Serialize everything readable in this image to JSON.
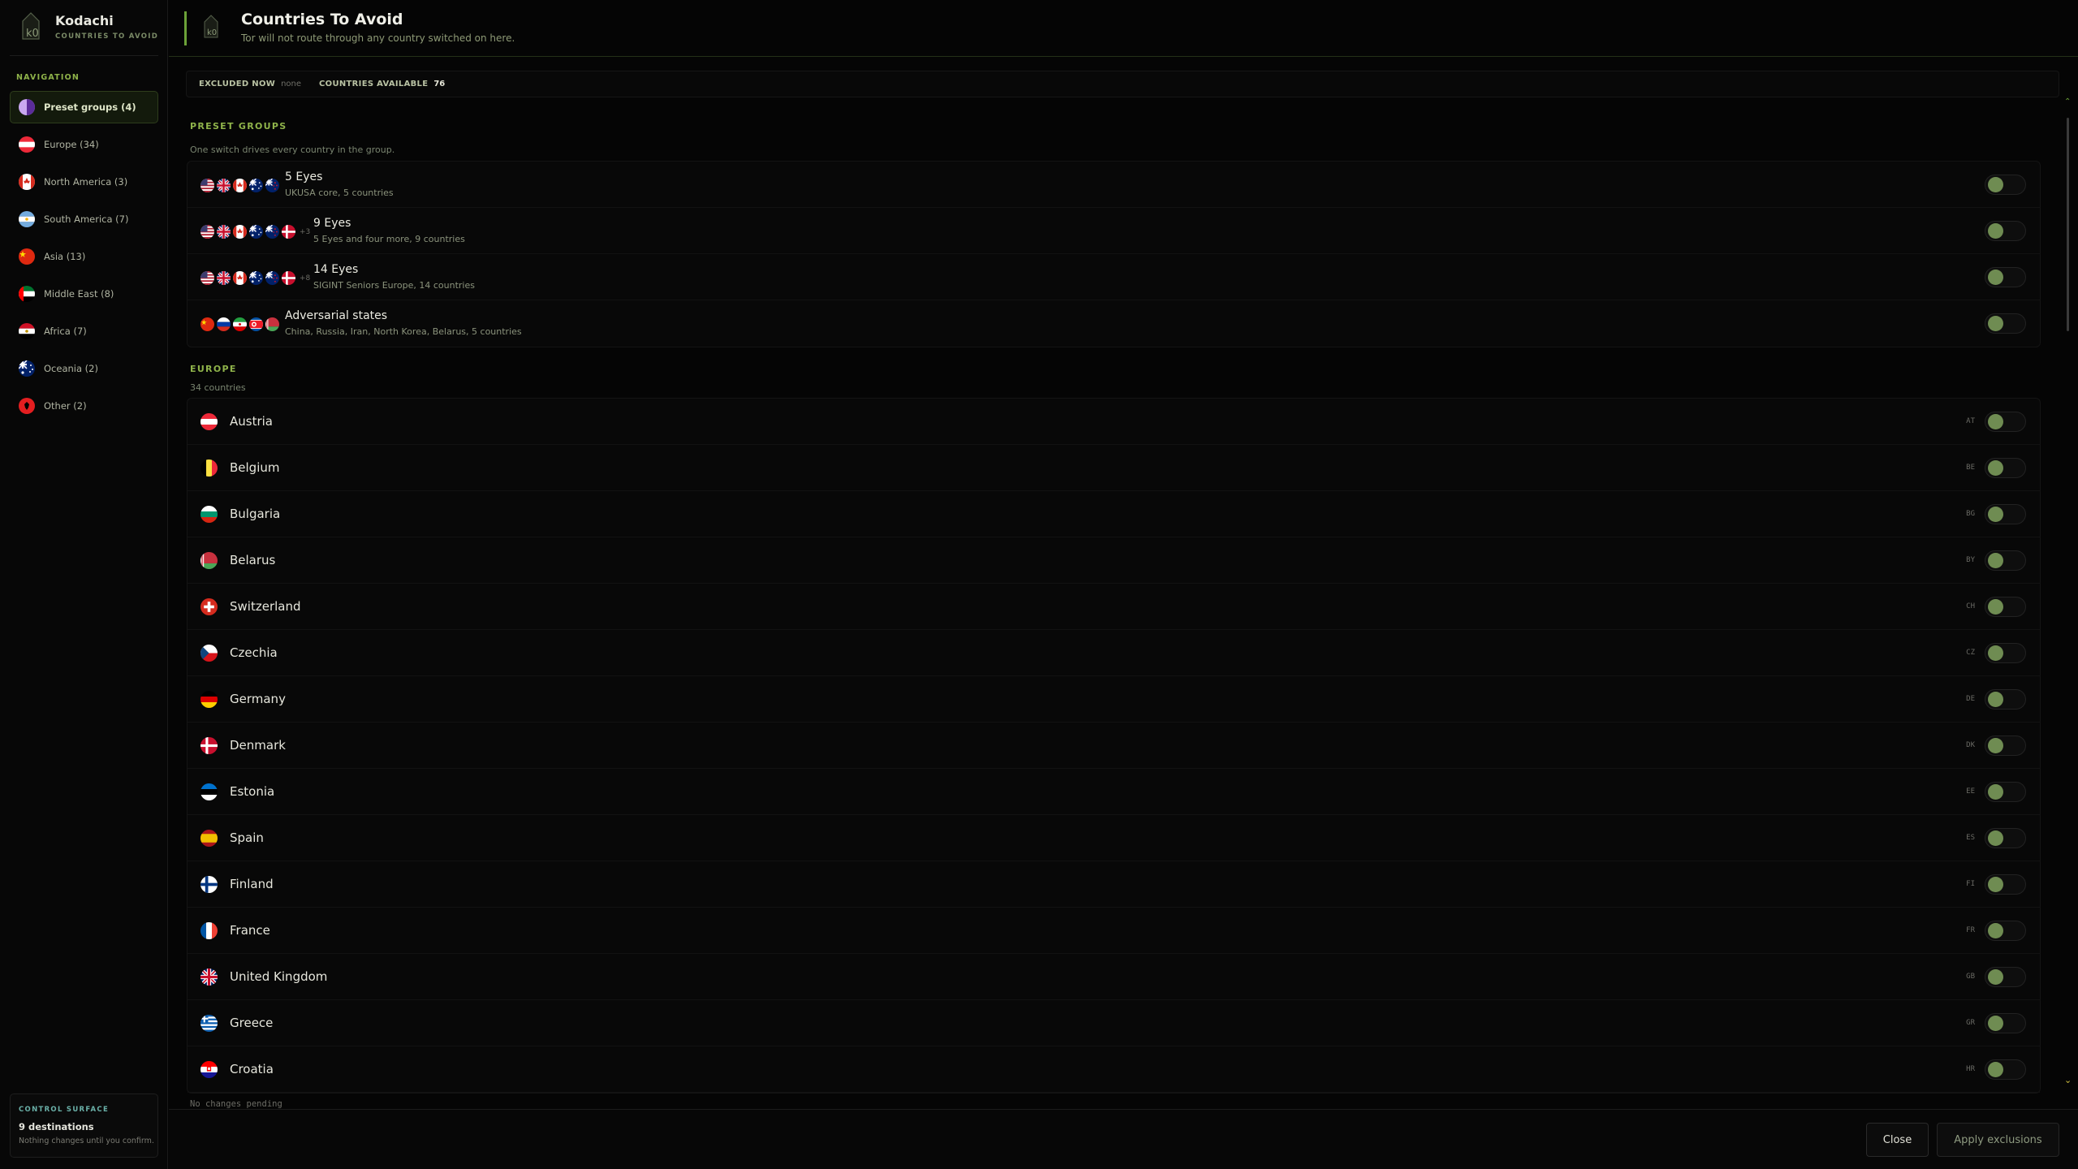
{
  "app": {
    "name": "Kodachi",
    "subtitle": "COUNTRIES TO AVOID"
  },
  "header": {
    "title": "Countries To Avoid",
    "subtitle": "Tor will not route through any country switched on here."
  },
  "sidebar": {
    "heading": "NAVIGATION",
    "items": [
      {
        "label": "Preset groups (4)",
        "flag": "eyes",
        "active": true
      },
      {
        "label": "Europe (34)",
        "flag": "AT"
      },
      {
        "label": "North America (3)",
        "flag": "CA"
      },
      {
        "label": "South America (7)",
        "flag": "AR"
      },
      {
        "label": "Asia (13)",
        "flag": "CN"
      },
      {
        "label": "Middle East (8)",
        "flag": "AE"
      },
      {
        "label": "Africa (7)",
        "flag": "EG"
      },
      {
        "label": "Oceania (2)",
        "flag": "AU"
      },
      {
        "label": "Other (2)",
        "flag": "AL"
      }
    ],
    "control": {
      "heading": "CONTROL SURFACE",
      "title": "9 destinations",
      "subtitle": "Nothing changes until you confirm."
    }
  },
  "status": {
    "excluded_label": "EXCLUDED NOW",
    "excluded_value": "none",
    "available_label": "COUNTRIES AVAILABLE",
    "available_value": "76"
  },
  "presets": {
    "heading": "PRESET GROUPS",
    "subtitle": "One switch drives every country in the group.",
    "groups": [
      {
        "name": "5 Eyes",
        "desc": "UKUSA core, 5 countries",
        "flags": [
          "US",
          "GB",
          "CA",
          "AU",
          "NZ"
        ],
        "more": ""
      },
      {
        "name": "9 Eyes",
        "desc": "5 Eyes and four more, 9 countries",
        "flags": [
          "US",
          "GB",
          "CA",
          "AU",
          "NZ",
          "DK"
        ],
        "more": "+3"
      },
      {
        "name": "14 Eyes",
        "desc": "SIGINT Seniors Europe, 14 countries",
        "flags": [
          "US",
          "GB",
          "CA",
          "AU",
          "NZ",
          "DK"
        ],
        "more": "+8"
      },
      {
        "name": "Adversarial states",
        "desc": "China, Russia, Iran, North Korea, Belarus, 5 countries",
        "flags": [
          "CN",
          "RU",
          "IR",
          "KP",
          "BY"
        ],
        "more": ""
      }
    ]
  },
  "europe": {
    "heading": "EUROPE",
    "subtitle": "34 countries",
    "countries": [
      {
        "name": "Austria",
        "code": "AT"
      },
      {
        "name": "Belgium",
        "code": "BE"
      },
      {
        "name": "Bulgaria",
        "code": "BG"
      },
      {
        "name": "Belarus",
        "code": "BY"
      },
      {
        "name": "Switzerland",
        "code": "CH"
      },
      {
        "name": "Czechia",
        "code": "CZ"
      },
      {
        "name": "Germany",
        "code": "DE"
      },
      {
        "name": "Denmark",
        "code": "DK"
      },
      {
        "name": "Estonia",
        "code": "EE"
      },
      {
        "name": "Spain",
        "code": "ES"
      },
      {
        "name": "Finland",
        "code": "FI"
      },
      {
        "name": "France",
        "code": "FR"
      },
      {
        "name": "United Kingdom",
        "code": "GB"
      },
      {
        "name": "Greece",
        "code": "GR"
      },
      {
        "name": "Croatia",
        "code": "HR"
      }
    ]
  },
  "footer": {
    "pending": "No changes pending",
    "close_label": "Close",
    "apply_label": "Apply exclusions"
  },
  "colors": {
    "accent": "#8fb34a",
    "knob": "#6f8c52",
    "background": "#050505"
  }
}
